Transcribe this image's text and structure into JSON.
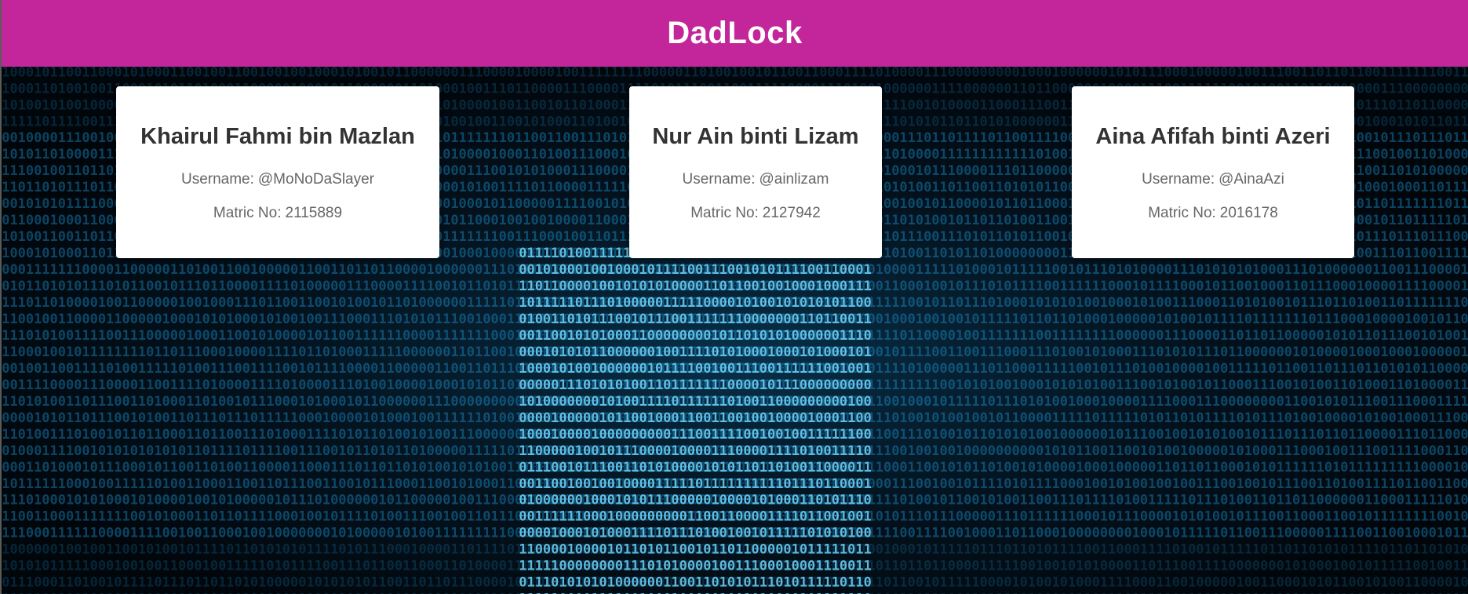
{
  "header": {
    "title": "DadLock",
    "background_color": "#c2269a"
  },
  "background": {
    "description_icon": "binary-code-background",
    "accent_color": "#1fb3ff"
  },
  "members": [
    {
      "name": "Khairul Fahmi bin Mazlan",
      "username_label": "Username:",
      "username": "@MoNoDaSlayer",
      "matric_label": "Matric No:",
      "matric": "2115889"
    },
    {
      "name": "Nur Ain binti Lizam",
      "username_label": "Username:",
      "username": "@ainlizam",
      "matric_label": "Matric No:",
      "matric": "2127942"
    },
    {
      "name": "Aina Afifah binti Azeri",
      "username_label": "Username:",
      "username": "@AinaAzi",
      "matric_label": "Matric No:",
      "matric": "2016178"
    }
  ]
}
